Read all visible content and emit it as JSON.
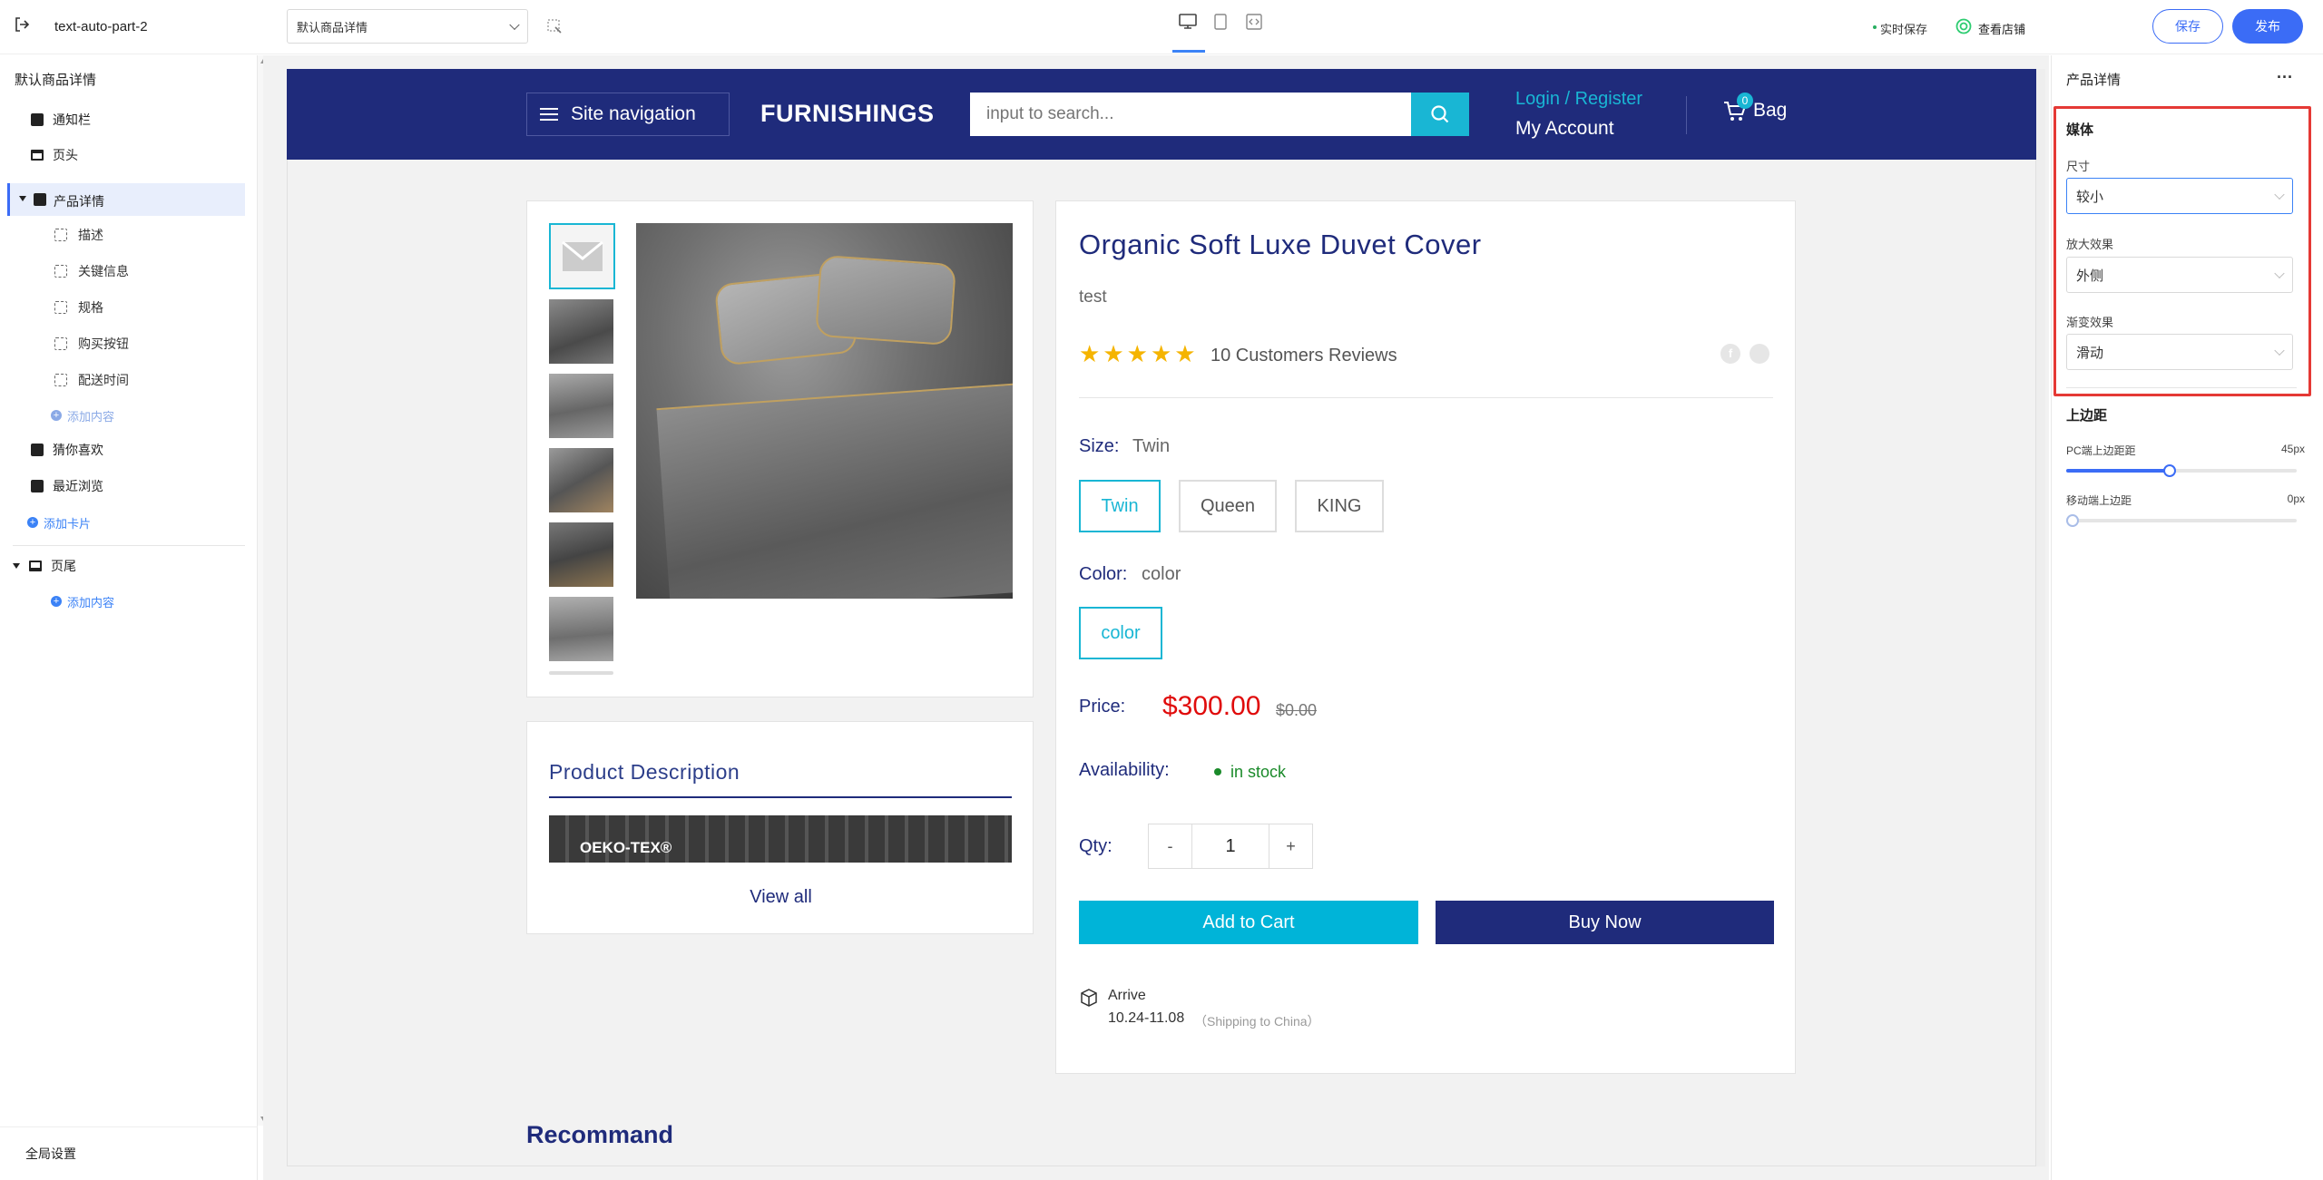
{
  "topbar": {
    "project_name": "text-auto-part-2",
    "page_select": "默认商品详情",
    "realtime_save": "实时保存",
    "view_store": "查看店铺",
    "save_label": "保存",
    "publish_label": "发布"
  },
  "left_panel": {
    "title": "默认商品详情",
    "items": [
      {
        "label": "通知栏"
      },
      {
        "label": "页头"
      },
      {
        "label": "产品详情"
      },
      {
        "label": "描述"
      },
      {
        "label": "关键信息"
      },
      {
        "label": "规格"
      },
      {
        "label": "购买按钮"
      },
      {
        "label": "配送时间"
      },
      {
        "label": "添加内容"
      },
      {
        "label": "猜你喜欢"
      },
      {
        "label": "最近浏览"
      },
      {
        "label": "添加卡片"
      },
      {
        "label": "页尾"
      },
      {
        "label": "添加内容"
      }
    ],
    "global_settings": "全局设置"
  },
  "store": {
    "nav_label": "Site navigation",
    "brand": "FURNISHINGS",
    "search_placeholder": "input to search...",
    "login_register": "Login / Register",
    "my_account": "My Account",
    "bag_count": "0",
    "bag_label": "Bag",
    "product_title": "Organic Soft Luxe Duvet Cover",
    "subtitle": "test",
    "rating": 5,
    "reviews": "10 Customers Reviews",
    "size_label": "Size:",
    "size_value": "Twin",
    "size_options": [
      "Twin",
      "Queen",
      "KING"
    ],
    "color_label": "Color:",
    "color_value": "color",
    "color_options": [
      "color"
    ],
    "price_label": "Price:",
    "price": "$300.00",
    "compare_price": "$0.00",
    "availability_label": "Availability:",
    "availability_value": "in stock",
    "qty_label": "Qty:",
    "qty_value": "1",
    "qty_minus": "-",
    "qty_plus": "+",
    "add_to_cart": "Add to Cart",
    "buy_now": "Buy Now",
    "arrive_label": "Arrive",
    "arrive_dates": "10.24-11.08",
    "arrive_note": "（Shipping to China）",
    "desc_title": "Product Description",
    "desc_image_text": "OEKO-TEX®",
    "view_all": "View all",
    "recommend": "Recommand"
  },
  "right_panel": {
    "title": "产品详情",
    "more": "···",
    "media_title": "媒体",
    "size_label": "尺寸",
    "size_value": "较小",
    "zoom_label": "放大效果",
    "zoom_value": "外侧",
    "fade_label": "渐变效果",
    "fade_value": "滑动",
    "margin_title": "上边距",
    "pc_margin_label": "PC端上边距距",
    "pc_margin_value": "45px",
    "pc_margin_fraction": 0.45,
    "mobile_margin_label": "移动端上边距",
    "mobile_margin_value": "0px",
    "mobile_margin_fraction": 0
  },
  "colors": {
    "header_navy": "#1f2b7b",
    "accent_cyan": "#00b4d8",
    "price_red": "#e00b0b",
    "publish_blue": "#3b6cf6",
    "highlight_red": "#e53935"
  }
}
